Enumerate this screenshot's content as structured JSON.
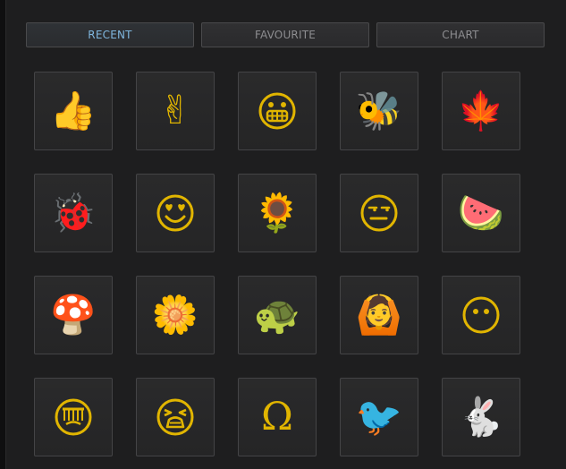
{
  "tabs": [
    {
      "label": "RECENT",
      "active": true
    },
    {
      "label": "FAVOURITE",
      "active": false
    },
    {
      "label": "CHART",
      "active": false
    }
  ],
  "grid": {
    "items": [
      {
        "icon": "thumbs-up-icon",
        "char": "👍"
      },
      {
        "icon": "victory-hand-icon",
        "char": "✌"
      },
      {
        "icon": "grinning-face-icon",
        "char": ""
      },
      {
        "icon": "bee-icon",
        "char": "🐝"
      },
      {
        "icon": "maple-leaf-icon",
        "char": "🍁"
      },
      {
        "icon": "ladybug-icon",
        "char": "🐞"
      },
      {
        "icon": "heart-eyes-face-icon",
        "char": ""
      },
      {
        "icon": "sunflower-icon",
        "char": "🌻"
      },
      {
        "icon": "unamused-face-icon",
        "char": ""
      },
      {
        "icon": "watermelon-icon",
        "char": "🍉"
      },
      {
        "icon": "mushroom-icon",
        "char": "🍄"
      },
      {
        "icon": "daisy-icon",
        "char": "🌼"
      },
      {
        "icon": "turtle-icon",
        "char": "🐢"
      },
      {
        "icon": "person-gesturing-ok-icon",
        "char": "🙆"
      },
      {
        "icon": "neutral-face-icon",
        "char": ""
      },
      {
        "icon": "grimacing-face-icon",
        "char": ""
      },
      {
        "icon": "tired-face-icon",
        "char": ""
      },
      {
        "icon": "omega-icon",
        "char": "Ω"
      },
      {
        "icon": "bird-icon",
        "char": "🐦"
      },
      {
        "icon": "rabbit-icon",
        "char": "🐇"
      }
    ]
  },
  "colors": {
    "accent": "#7fb6de",
    "glyph": "#e1b500",
    "background": "#1e1e1f",
    "cell": "#252526"
  }
}
